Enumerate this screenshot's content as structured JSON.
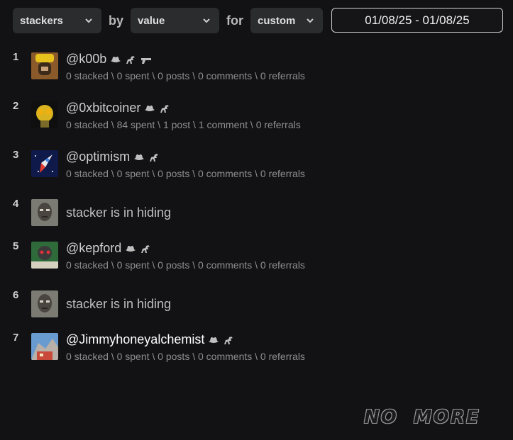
{
  "filters": {
    "what": "stackers",
    "by_word": "by",
    "by_value": "value",
    "for_word": "for",
    "for_value": "custom",
    "date_range": "01/08/25 - 01/08/25"
  },
  "rows": [
    {
      "rank": "1",
      "name": "@k00b",
      "stats": "0 stacked \\ 0 spent \\ 0 posts \\ 0 comments \\ 0 referrals",
      "badges": [
        "cowboy-hat",
        "horse",
        "gun"
      ]
    },
    {
      "rank": "2",
      "name": "@0xbitcoiner",
      "stats": "0 stacked \\ 84 spent \\ 1 post \\ 1 comment \\ 0 referrals",
      "badges": [
        "cowboy-hat",
        "horse"
      ]
    },
    {
      "rank": "3",
      "name": "@optimism",
      "stats": "0 stacked \\ 0 spent \\ 0 posts \\ 0 comments \\ 0 referrals",
      "badges": [
        "cowboy-hat",
        "horse"
      ]
    },
    {
      "rank": "4",
      "hidden_text": "stacker is in hiding"
    },
    {
      "rank": "5",
      "name": "@kepford",
      "stats": "0 stacked \\ 0 spent \\ 0 posts \\ 0 comments \\ 0 referrals",
      "badges": [
        "cowboy-hat",
        "horse"
      ]
    },
    {
      "rank": "6",
      "hidden_text": "stacker is in hiding"
    },
    {
      "rank": "7",
      "name": "@Jimmyhoneyalchemist",
      "stats": "0 stacked \\ 0 spent \\ 0 posts \\ 0 comments \\ 0 referrals",
      "badges": [
        "cowboy-hat",
        "horse"
      ]
    }
  ],
  "footer": {
    "no_more_1": "NO",
    "no_more_2": "MORE"
  }
}
